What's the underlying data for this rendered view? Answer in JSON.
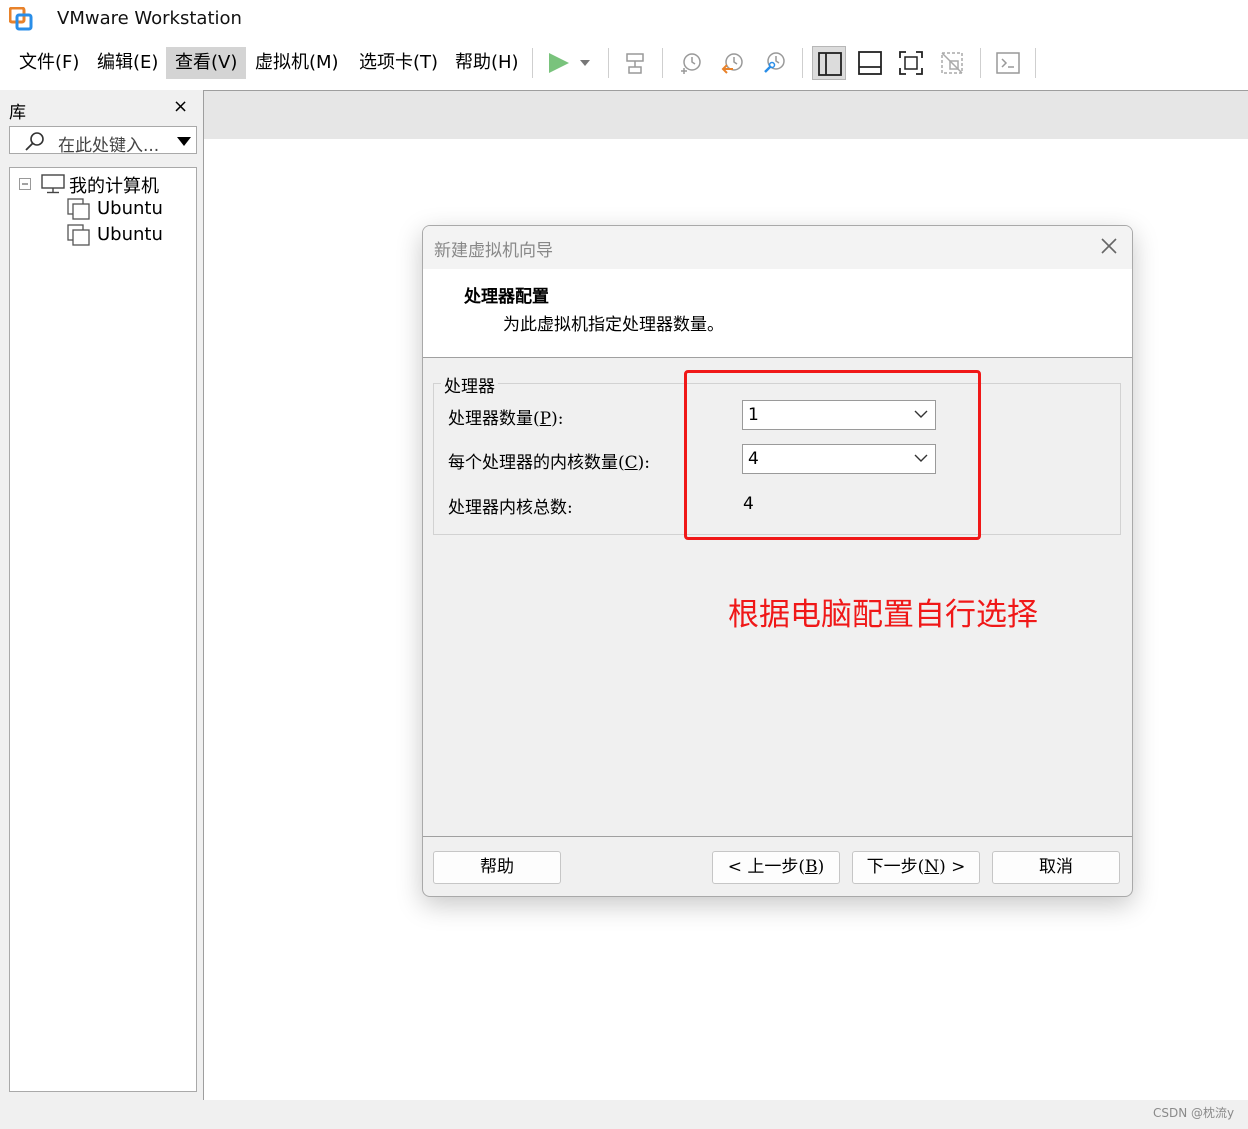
{
  "window": {
    "title": "VMware Workstation"
  },
  "menu": {
    "items": [
      {
        "label": "文件(F)"
      },
      {
        "label": "编辑(E)"
      },
      {
        "label": "查看(V)"
      },
      {
        "label": "虚拟机(M)"
      },
      {
        "label": "选项卡(T)"
      },
      {
        "label": "帮助(H)"
      }
    ],
    "active_item": "查看(V)"
  },
  "library": {
    "title": "库",
    "close": "×",
    "search_placeholder": "在此处键入...",
    "tree": {
      "root": "我的计算机",
      "children": [
        {
          "label": "Ubuntu"
        },
        {
          "label": "Ubuntu"
        }
      ]
    }
  },
  "dialog": {
    "title": "新建虚拟机向导",
    "header_title": "处理器配置",
    "header_subtitle": "为此虚拟机指定处理器数量。",
    "group_label": "处理器",
    "fields": {
      "processor_count": {
        "label_text": "处理器数量(",
        "mnemonic": "P",
        "label_end": "):",
        "value": "1"
      },
      "cores_per_processor": {
        "label_text": "每个处理器的内核数量(",
        "mnemonic": "C",
        "label_end": "):",
        "value": "4"
      },
      "total_cores": {
        "label": "处理器内核总数:",
        "value": "4"
      }
    },
    "buttons": {
      "help": "帮助",
      "back_prefix": "< 上一步(",
      "back_mnemonic": "B",
      "back_suffix": ")",
      "next_prefix": "下一步(",
      "next_mnemonic": "N",
      "next_suffix": ") >",
      "cancel": "取消"
    }
  },
  "annotation": {
    "text": "根据电脑配置自行选择",
    "color": "#f01818"
  },
  "watermark": "CSDN @枕流y",
  "colors": {
    "accent_red": "#f01818",
    "play_green": "#4caf50"
  }
}
